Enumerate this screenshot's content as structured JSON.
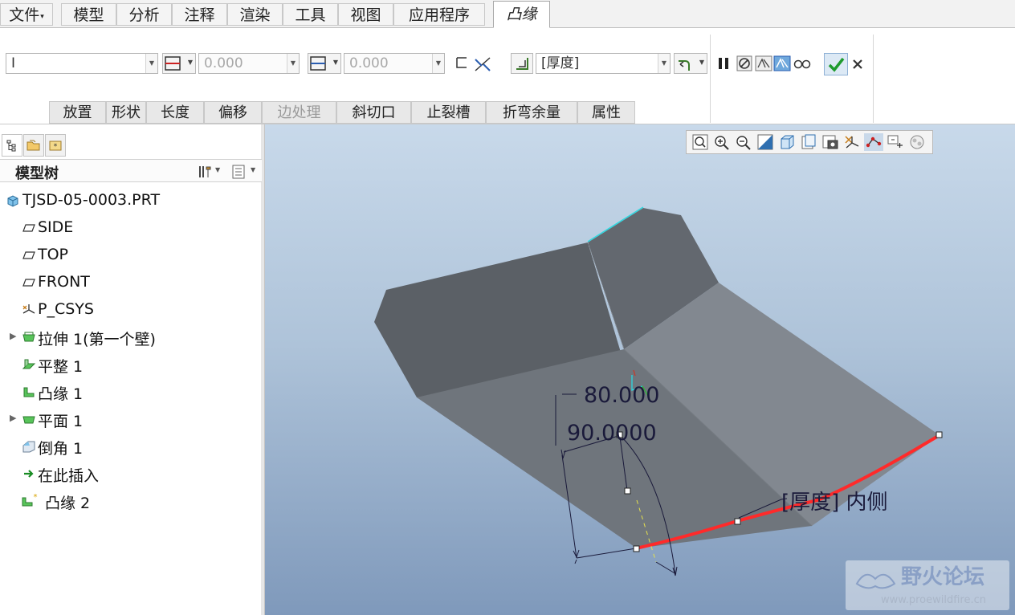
{
  "menubar": {
    "file": "文件",
    "tabs": [
      "模型",
      "分析",
      "注释",
      "渲染",
      "工具",
      "视图",
      "应用程序"
    ],
    "active_tab": "凸缘"
  },
  "ribbon": {
    "shape_combo": "I",
    "length1_value": "0.000",
    "length2_value": "0.000",
    "thickness_combo": "[厚度]",
    "subtabs": [
      "放置",
      "形状",
      "长度",
      "偏移",
      "边处理",
      "斜切口",
      "止裂槽",
      "折弯余量",
      "属性"
    ],
    "disabled_subtab_index": 4,
    "icons": {
      "length1": "length-end1-icon",
      "length2": "length-end2-icon",
      "flip": "flip-direction-icon",
      "thickness_side": "thickness-side-icon",
      "bend_side": "bend-side-icon",
      "pause": "pause-icon",
      "no_preview": "no-preview-icon",
      "preview1": "preview-icon",
      "preview2": "verify-icon",
      "glasses": "glasses-icon",
      "ok": "checkmark-icon",
      "cancel": "close-icon"
    }
  },
  "model_tree": {
    "title": "模型树",
    "items": [
      {
        "label": "TJSD-05-0003.PRT",
        "icon": "part-icon",
        "expandable": false,
        "indent": 0
      },
      {
        "label": "SIDE",
        "icon": "datum-plane-icon",
        "expandable": false,
        "indent": 1
      },
      {
        "label": "TOP",
        "icon": "datum-plane-icon",
        "expandable": false,
        "indent": 1
      },
      {
        "label": "FRONT",
        "icon": "datum-plane-icon",
        "expandable": false,
        "indent": 1
      },
      {
        "label": "P_CSYS",
        "icon": "csys-icon",
        "expandable": false,
        "indent": 1
      },
      {
        "label": "拉伸 1(第一个壁)",
        "icon": "extrude-wall-icon",
        "expandable": true,
        "indent": 1
      },
      {
        "label": "平整 1",
        "icon": "flat-wall-icon",
        "expandable": false,
        "indent": 1
      },
      {
        "label": "凸缘 1",
        "icon": "flange-wall-icon",
        "expandable": false,
        "indent": 1
      },
      {
        "label": "平面 1",
        "icon": "planar-wall-icon",
        "expandable": true,
        "indent": 1
      },
      {
        "label": "倒角 1",
        "icon": "chamfer-icon",
        "expandable": false,
        "indent": 1
      },
      {
        "label": "在此插入",
        "icon": "insert-here-arrow-icon",
        "expandable": false,
        "indent": 1
      },
      {
        "label": "凸缘 2",
        "icon": "flange-wall-new-icon",
        "expandable": false,
        "indent": 1
      }
    ]
  },
  "graphics": {
    "dim_length": "80.000",
    "dim_angle": "90.0000",
    "thickness_label": "[厚度] 内侧",
    "watermark_cn": "野火论坛",
    "watermark_url": "www.proewildfire.cn",
    "colors": {
      "bg_top": "#c8d9ea",
      "bg_bottom": "#7f99bb",
      "surface_dark": "#5b6066",
      "surface_mid": "#6f757c",
      "surface_light": "#828890",
      "highlight_edge": "#ff2a2a",
      "accent_edge": "#2ed8e0"
    }
  }
}
